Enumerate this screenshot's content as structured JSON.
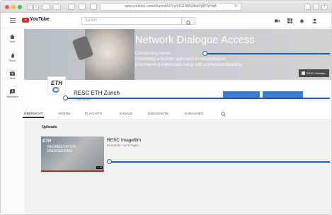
{
  "browser": {
    "url": "www.youtube.com/channel/UCnyVtG1MWy8bnPg8TIyHqA",
    "nav_back": "‹",
    "nav_forward": "›"
  },
  "youtube": {
    "logo_text": "YouTube",
    "logo_sup": "CH",
    "search_placeholder": "Suchen",
    "sidebar": [
      {
        "label": "Start"
      },
      {
        "label": "Trends"
      },
      {
        "label": "Abos"
      },
      {
        "label": "Mediathek"
      }
    ]
  },
  "banner": {
    "title": "Network Dialogue Access",
    "line1": "Connecting minds.",
    "line2": "Promoting a holistic approach to rehabilitation.",
    "line3": "Empowering individuals living with a physical disability.",
    "badge": "RESC Website"
  },
  "channel": {
    "avatar_text": "ETH",
    "name": "RESC ETH Zürich",
    "subscribers": "2 Abonnenten",
    "tabs": [
      "ÜBERSICHT",
      "VIDEOS",
      "PLAYLISTS",
      "KANÄLE",
      "DISKUSSION",
      "KANALINFO"
    ]
  },
  "uploads": {
    "heading": "Uploads",
    "video": {
      "title": "RESC Imagefilm",
      "meta": "81 Aufrufe • vor 5 Tagen",
      "duration": "1:15",
      "thumb_logo": "ETH",
      "thumb_text": "REHABILITATION ENGINEERING"
    }
  },
  "colors": {
    "accent": "#3d7bd5",
    "callout": "#1a5ea8",
    "youtube_red": "#e52d27"
  }
}
